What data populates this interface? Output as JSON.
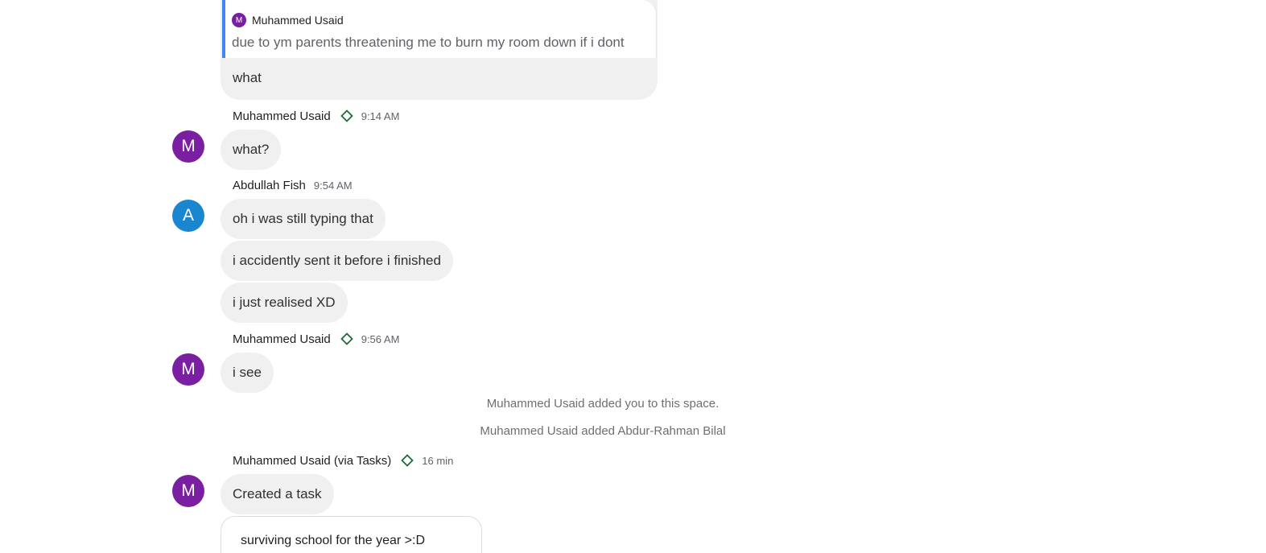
{
  "quoted": {
    "author_initial": "M",
    "author": "Muhammed Usaid",
    "text": "due to ym parents threatening me to burn my room down if i dont",
    "reply": "what"
  },
  "messages": [
    {
      "sender": "Muhammed Usaid",
      "initial": "M",
      "time": "9:14 AM",
      "lines": [
        "what?"
      ]
    },
    {
      "sender": "Abdullah Fish",
      "initial": "A",
      "time": "9:54 AM",
      "lines": [
        "oh i was still typing that",
        "i accidently sent it before i finished",
        "i just realised XD"
      ]
    },
    {
      "sender": "Muhammed Usaid",
      "initial": "M",
      "time": "9:56 AM",
      "lines": [
        "i see"
      ]
    }
  ],
  "system_messages": [
    "Muhammed Usaid added you to this space.",
    "Muhammed Usaid added Abdur-Rahman Bilal"
  ],
  "task_message": {
    "sender": "Muhammed Usaid (via Tasks)",
    "initial": "M",
    "time": "16 min",
    "text": "Created a task",
    "task_title": "surviving school for the year >:D"
  },
  "colors": {
    "avatar_purple": "#7b1fa2",
    "avatar_blue": "#1a86d0",
    "quote_bar": "#4285f4",
    "badge_green": "#1e6b3a"
  },
  "icons": {
    "role_badge": "diamond-outline-icon"
  }
}
